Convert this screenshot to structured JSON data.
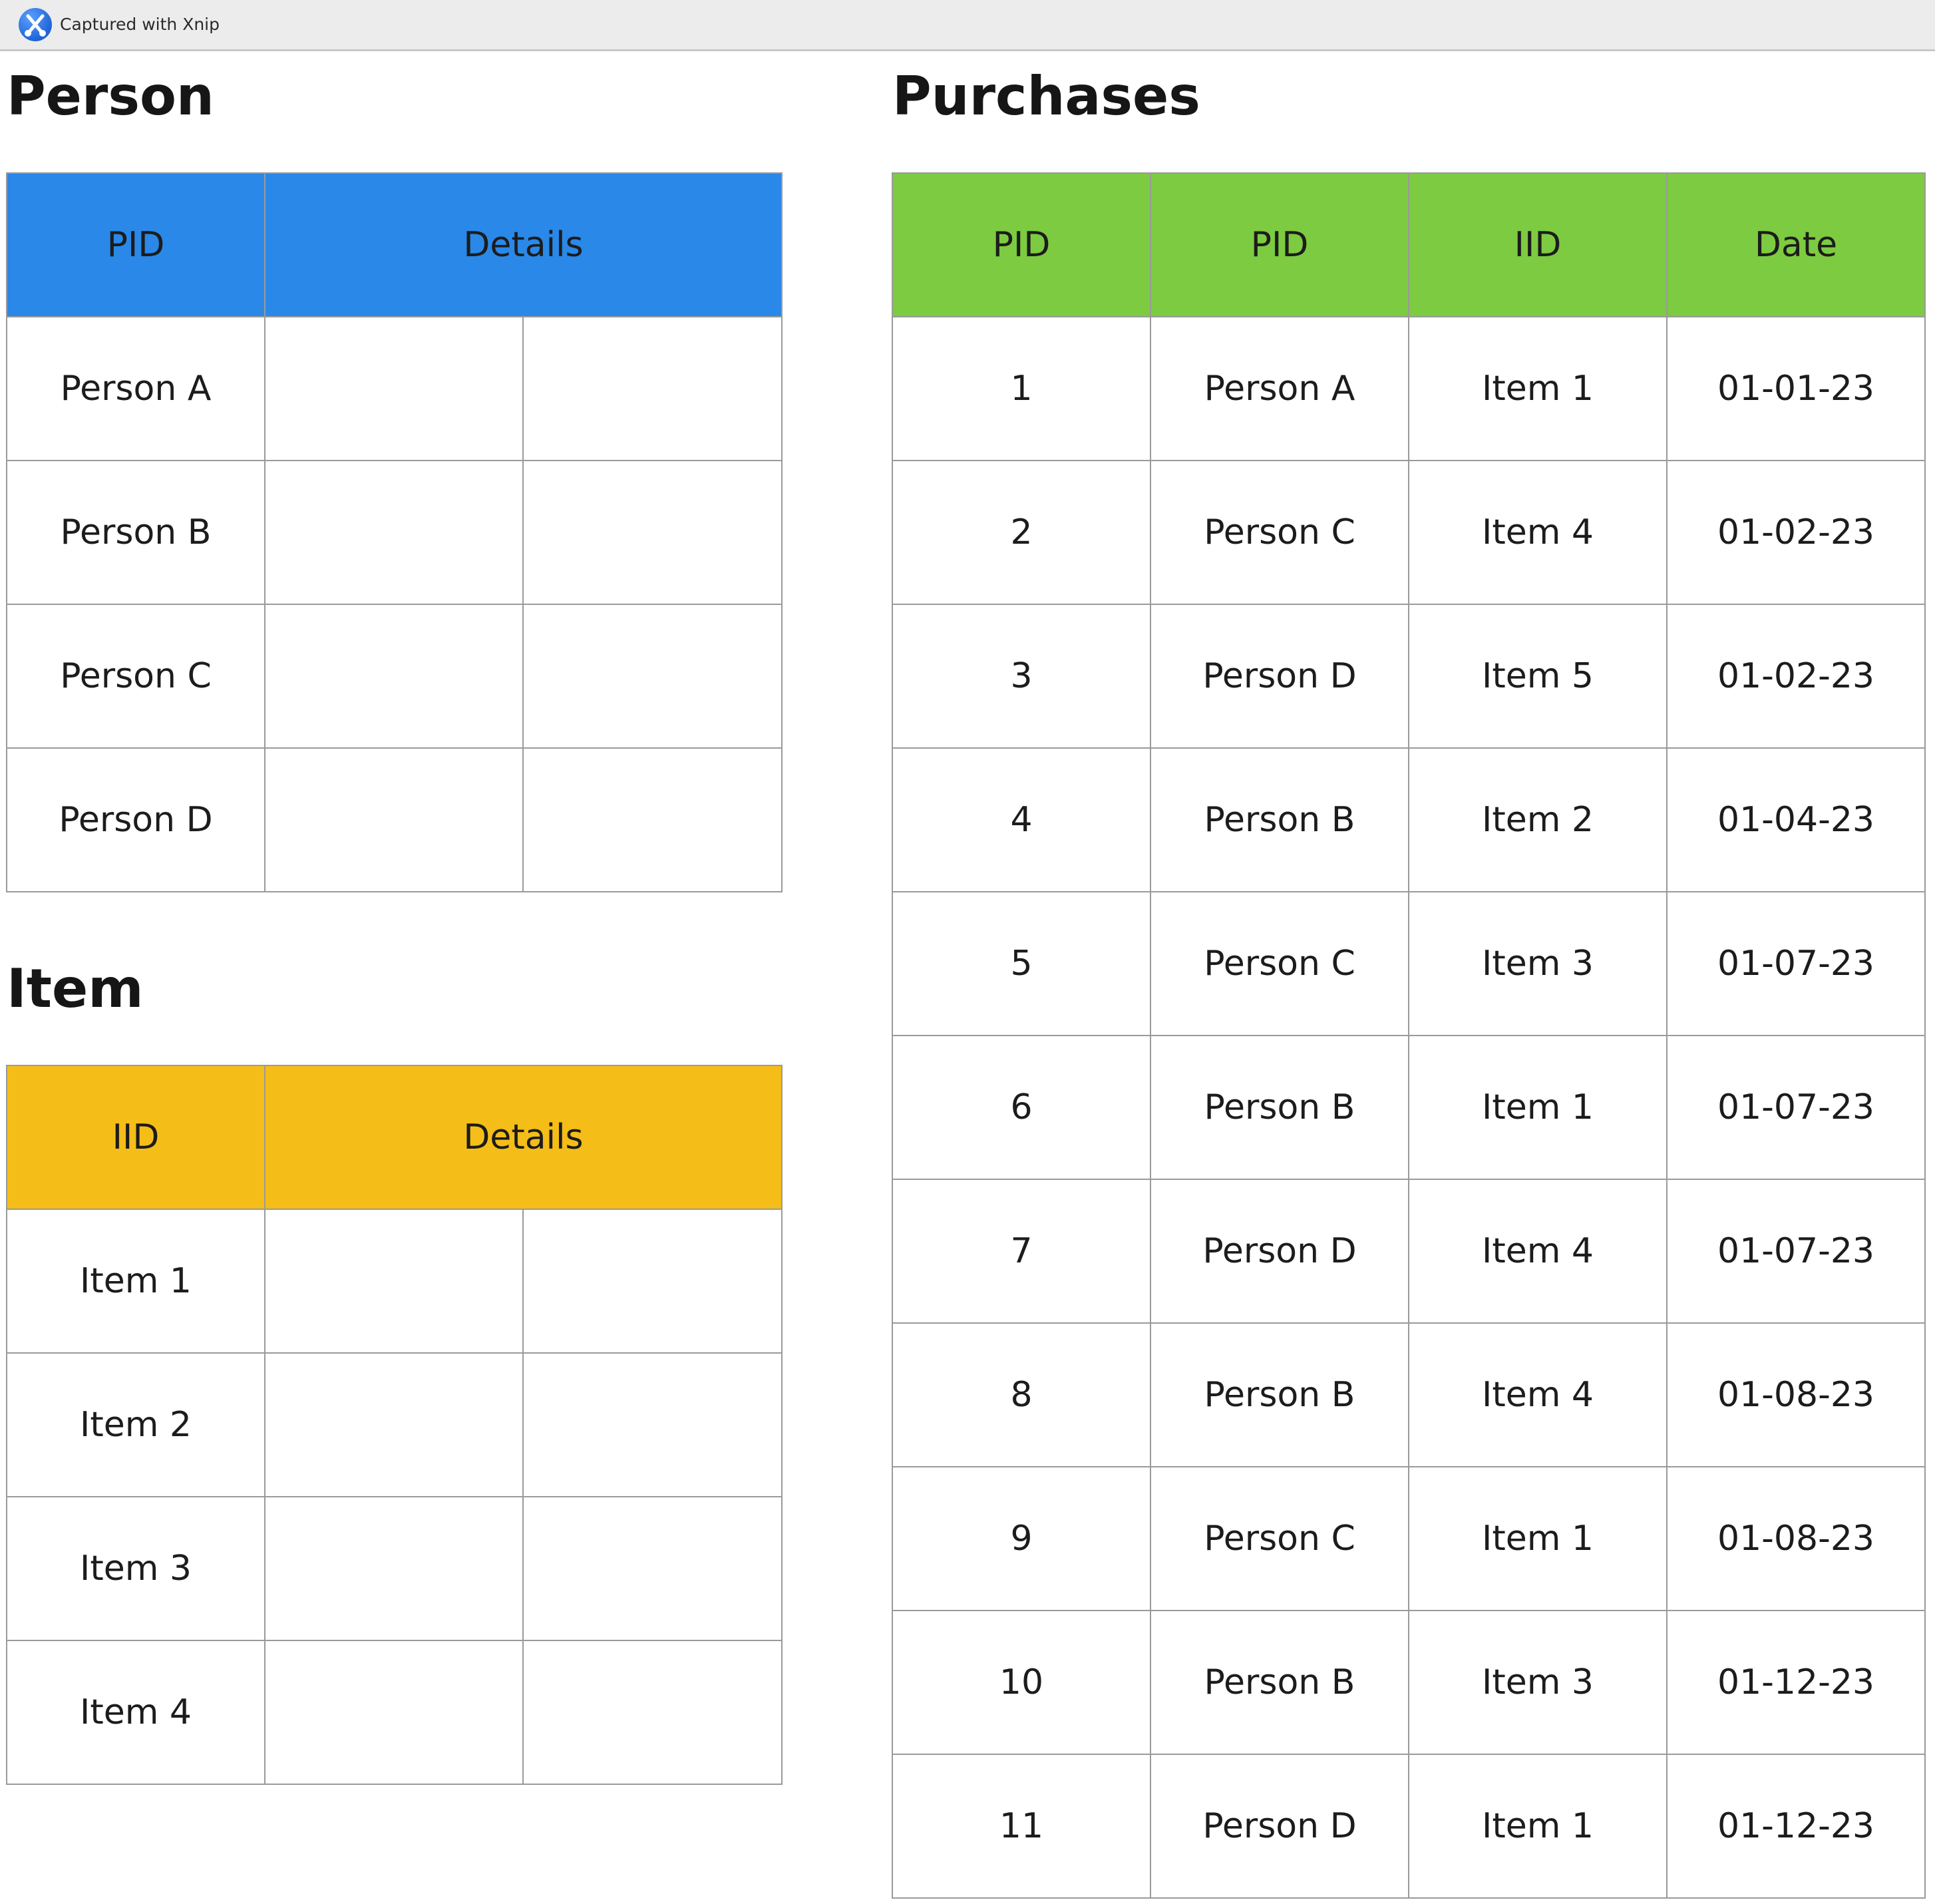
{
  "capture_bar": {
    "label": "Captured with Xnip",
    "logo_icon": "xnip-scissors-icon"
  },
  "colors": {
    "person_header": "#2a88e8",
    "item_header": "#f5bd17",
    "purchases_header": "#7dcb40"
  },
  "person": {
    "title": "Person",
    "headers": [
      "PID",
      "Details"
    ],
    "rows": [
      "Person A",
      "Person B",
      "Person C",
      "Person D"
    ]
  },
  "item": {
    "title": "Item",
    "headers": [
      "IID",
      "Details"
    ],
    "rows": [
      "Item 1",
      "Item 2",
      "Item 3",
      "Item 4"
    ]
  },
  "purchases": {
    "title": "Purchases",
    "headers": [
      "PID",
      "PID",
      "IID",
      "Date"
    ],
    "rows": [
      [
        "1",
        "Person A",
        "Item 1",
        "01-01-23"
      ],
      [
        "2",
        "Person C",
        "Item 4",
        "01-02-23"
      ],
      [
        "3",
        "Person D",
        "Item 5",
        "01-02-23"
      ],
      [
        "4",
        "Person B",
        "Item 2",
        "01-04-23"
      ],
      [
        "5",
        "Person C",
        "Item 3",
        "01-07-23"
      ],
      [
        "6",
        "Person B",
        "Item 1",
        "01-07-23"
      ],
      [
        "7",
        "Person D",
        "Item 4",
        "01-07-23"
      ],
      [
        "8",
        "Person B",
        "Item 4",
        "01-08-23"
      ],
      [
        "9",
        "Person C",
        "Item 1",
        "01-08-23"
      ],
      [
        "10",
        "Person B",
        "Item 3",
        "01-12-23"
      ],
      [
        "11",
        "Person D",
        "Item 1",
        "01-12-23"
      ]
    ]
  }
}
